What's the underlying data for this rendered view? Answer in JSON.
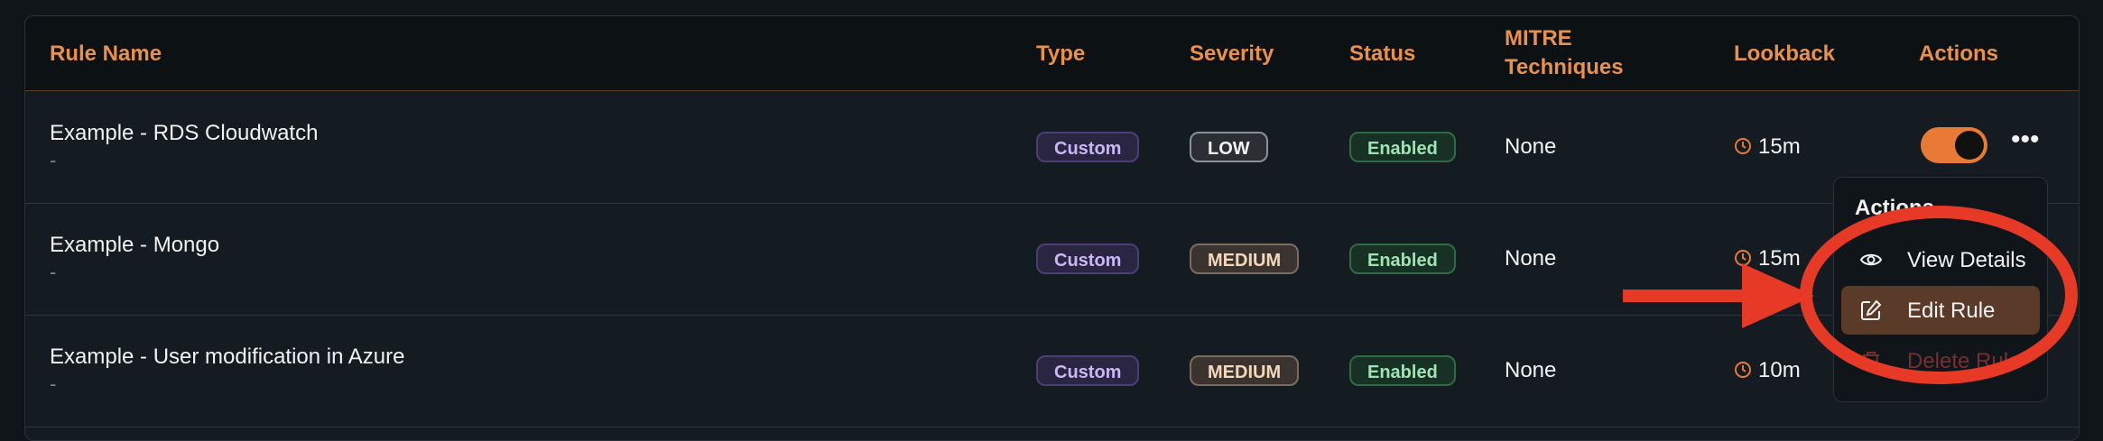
{
  "table": {
    "headers": {
      "rule_name": "Rule Name",
      "type": "Type",
      "severity": "Severity",
      "status": "Status",
      "mitre_line1": "MITRE",
      "mitre_line2": "Techniques",
      "lookback": "Lookback",
      "actions": "Actions"
    },
    "rows": [
      {
        "name": "Example - RDS Cloudwatch",
        "description": "-",
        "type": "Custom",
        "severity": "LOW",
        "status": "Enabled",
        "mitre": "None",
        "lookback": "15m",
        "toggle_on": true
      },
      {
        "name": "Example - Mongo",
        "description": "-",
        "type": "Custom",
        "severity": "MEDIUM",
        "status": "Enabled",
        "mitre": "None",
        "lookback": "15m"
      },
      {
        "name": "Example - User modification in Azure",
        "description": "-",
        "type": "Custom",
        "severity": "MEDIUM",
        "status": "Enabled",
        "mitre": "None",
        "lookback": "10m"
      }
    ]
  },
  "actions_menu": {
    "title": "Actions",
    "items": [
      {
        "label": "View Details",
        "icon": "eye-icon"
      },
      {
        "label": "Edit Rule",
        "icon": "edit-icon",
        "highlighted": true
      },
      {
        "label": "Delete Rule",
        "icon": "trash-icon"
      }
    ]
  },
  "colors": {
    "accent": "#e87a35",
    "header_text": "#e9914b",
    "annotation_red": "#e63a26",
    "menu_highlight": "#5a3a28"
  },
  "icons": {
    "lookback": "clock-icon",
    "more": "more-horizontal-icon"
  }
}
